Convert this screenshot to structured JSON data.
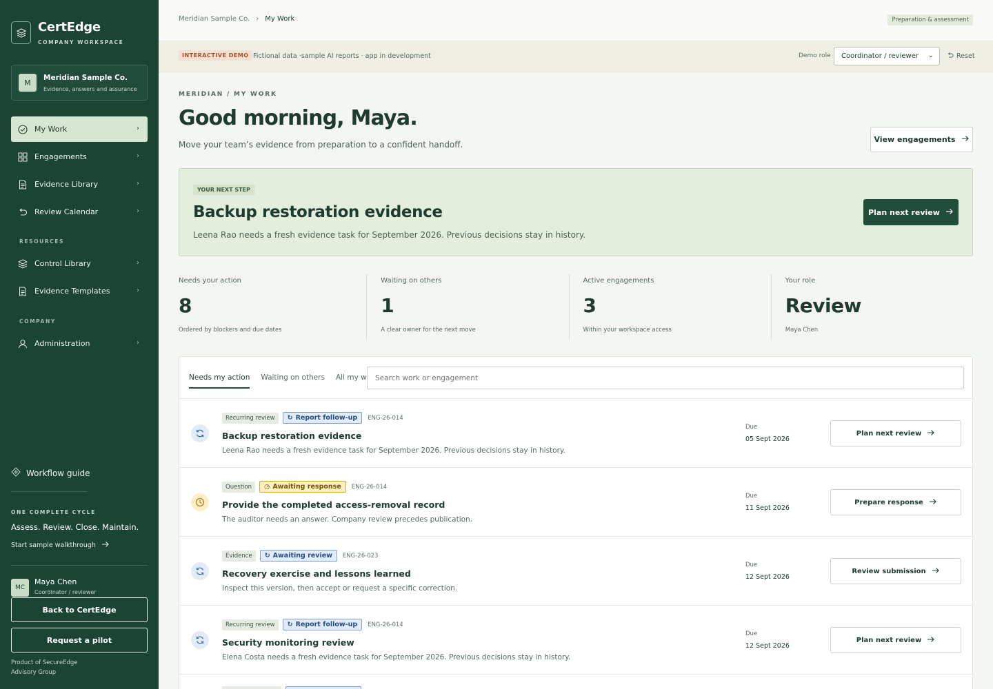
{
  "brand": {
    "name": "CertEdge",
    "sub": "COMPANY WORKSPACE"
  },
  "company": {
    "initial": "M",
    "name": "Meridian Sample Co.",
    "sub": "Evidence, answers and assurance"
  },
  "nav": {
    "main": [
      {
        "label": "My Work",
        "icon": "check-circle-icon",
        "active": true
      },
      {
        "label": "Engagements",
        "icon": "grid-icon"
      },
      {
        "label": "Evidence Library",
        "icon": "document-icon"
      },
      {
        "label": "Review Calendar",
        "icon": "undo-arrow-icon"
      }
    ],
    "resources_label": "RESOURCES",
    "resources": [
      {
        "label": "Control Library",
        "icon": "layers-icon"
      },
      {
        "label": "Evidence Templates",
        "icon": "document-icon"
      }
    ],
    "company_label": "COMPANY",
    "company_items": [
      {
        "label": "Administration",
        "icon": "user-icon"
      }
    ]
  },
  "sidebar_footer": {
    "guide": "Workflow guide",
    "cycle_label": "ONE COMPLETE CYCLE",
    "cycle_text": "Assess. Review. Close. Maintain.",
    "walkthrough": "Start sample walkthrough",
    "user": {
      "initials": "MC",
      "name": "Maya Chen",
      "role": "Coordinator / reviewer"
    },
    "back_button": "Back to CertEdge",
    "pilot_button": "Request a pilot",
    "note_line1": "Product of SecureEdge",
    "note_line2": "Advisory Group"
  },
  "topbar": {
    "crumb_root": "Meridian Sample Co.",
    "crumb_current": "My Work",
    "phase": "Preparation & assessment"
  },
  "demobar": {
    "badge": "INTERACTIVE DEMO",
    "text": "Fictional data ·sample AI reports · app in development",
    "role_label": "Demo role",
    "role_value": "Coordinator / reviewer",
    "reset": "Reset"
  },
  "header": {
    "eyebrow": "MERIDIAN / MY WORK",
    "greeting": "Good morning, Maya.",
    "subtitle": "Move your team’s evidence from preparation to a confident handoff.",
    "view_button": "View engagements"
  },
  "next_step": {
    "badge": "YOUR NEXT STEP",
    "title": "Backup restoration evidence",
    "desc": "Leena Rao needs a fresh evidence task for September 2026. Previous decisions stay in history.",
    "button": "Plan next review"
  },
  "stats": [
    {
      "label": "Needs your action",
      "value": "8",
      "note": "Ordered by blockers and due dates"
    },
    {
      "label": "Waiting on others",
      "value": "1",
      "note": "A clear owner for the next move"
    },
    {
      "label": "Active engagements",
      "value": "3",
      "note": "Within your workspace access"
    },
    {
      "label": "Your role",
      "value": "Review",
      "note": "Maya Chen"
    }
  ],
  "work": {
    "tabs": [
      "Needs my action",
      "Waiting on others",
      "All my work"
    ],
    "search_placeholder": "Search work or engagement",
    "due_label": "Due",
    "rows": [
      {
        "icon": "refresh-icon",
        "icon_tone": "blue",
        "type": "Recurring review",
        "status": "Report follow-up",
        "status_tone": "blue",
        "eng": "ENG-26-014",
        "title": "Backup restoration evidence",
        "desc": "Leena Rao needs a fresh evidence task for September 2026. Previous decisions stay in history.",
        "due": "05 Sept 2026",
        "action": "Plan next review"
      },
      {
        "icon": "clock-icon",
        "icon_tone": "amber",
        "type": "Question",
        "status": "Awaiting response",
        "status_tone": "amber",
        "eng": "ENG-26-014",
        "title": "Provide the completed access-removal record",
        "desc": "The auditor needs an answer. Company review precedes publication.",
        "due": "11 Sept 2026",
        "action": "Prepare response"
      },
      {
        "icon": "refresh-icon",
        "icon_tone": "blue",
        "type": "Evidence",
        "status": "Awaiting review",
        "status_tone": "blue",
        "eng": "ENG-26-023",
        "title": "Recovery exercise and lessons learned",
        "desc": "Inspect this version, then accept or request a specific correction.",
        "due": "12 Sept 2026",
        "action": "Review submission"
      },
      {
        "icon": "refresh-icon",
        "icon_tone": "blue",
        "type": "Recurring review",
        "status": "Report follow-up",
        "status_tone": "blue",
        "eng": "ENG-26-014",
        "title": "Security monitoring review",
        "desc": "Elena Costa needs a fresh evidence task for September 2026. Previous decisions stay in history.",
        "due": "12 Sept 2026",
        "action": "Plan next review"
      }
    ]
  },
  "colors": {
    "sidebar": "#1c4434",
    "accent": "#214d3a",
    "card": "#e4eedd"
  }
}
